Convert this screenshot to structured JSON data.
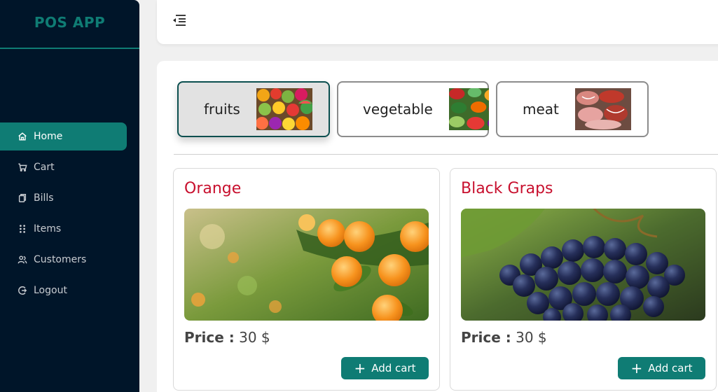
{
  "app": {
    "title": "POS APP"
  },
  "sidebar": {
    "items": [
      {
        "label": "Home",
        "icon": "home-icon",
        "active": true
      },
      {
        "label": "Cart",
        "icon": "cart-icon"
      },
      {
        "label": "Bills",
        "icon": "copy-icon"
      },
      {
        "label": "Items",
        "icon": "grid-icon"
      },
      {
        "label": "Customers",
        "icon": "users-icon"
      },
      {
        "label": "Logout",
        "icon": "logout-icon"
      }
    ]
  },
  "header": {
    "menu_icon": "menu-fold-icon"
  },
  "categories": [
    {
      "label": "fruits",
      "active": true
    },
    {
      "label": "vegetable"
    },
    {
      "label": "meat"
    }
  ],
  "products": [
    {
      "name": "Orange",
      "price_label": "Price :",
      "price": "30 $",
      "button": "Add cart"
    },
    {
      "name": "Black Graps",
      "price_label": "Price :",
      "price": "30 $",
      "button": "Add cart"
    }
  ],
  "colors": {
    "accent": "#0f7c74",
    "sidebar": "#001529",
    "product_title": "#c8102e"
  }
}
